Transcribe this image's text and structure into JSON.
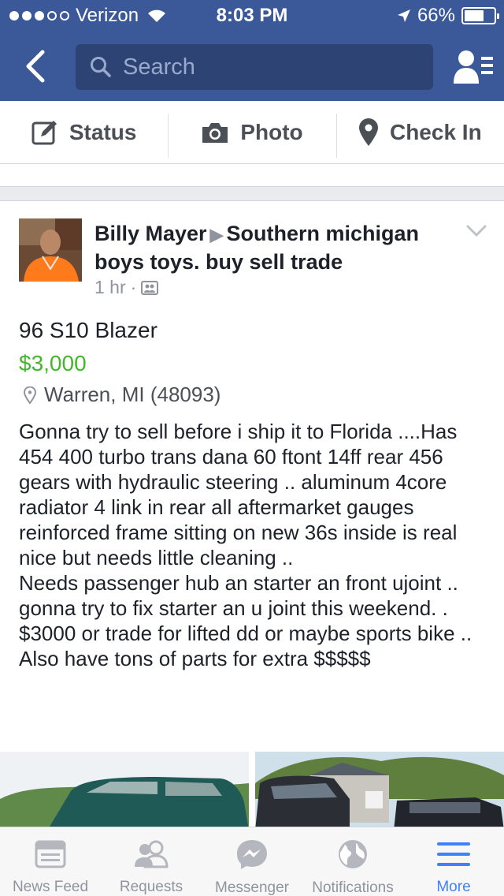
{
  "status_bar": {
    "carrier": "Verizon",
    "time": "8:03 PM",
    "battery": "66%",
    "battery_level": 0.66
  },
  "nav": {
    "search_placeholder": "Search"
  },
  "composer": {
    "status_label": "Status",
    "photo_label": "Photo",
    "checkin_label": "Check In"
  },
  "post": {
    "author": "Billy Mayer",
    "group": "Southern michigan boys toys. buy sell trade",
    "time_ago": "1 hr",
    "title": "96 S10 Blazer",
    "price": "$3,000",
    "location": "Warren, MI (48093)",
    "body": "Gonna try to sell before i ship it to Florida ....Has 454 400 turbo trans dana 60 ftont 14ff rear 456 gears with hydraulic steering .. aluminum 4core radiator  4 link in rear all aftermarket gauges reinforced frame sitting on new 36s inside is real nice but needs little cleaning ..\nNeeds passenger hub an starter an front ujoint .. gonna try to fix starter an u joint this weekend. . $3000 or trade for lifted dd or maybe sports bike .. Also have tons of parts for extra $$$$$"
  },
  "tabs": [
    {
      "label": "News Feed",
      "icon": "news-feed-icon"
    },
    {
      "label": "Requests",
      "icon": "friend-requests-icon"
    },
    {
      "label": "Messenger",
      "icon": "messenger-icon"
    },
    {
      "label": "Notifications",
      "icon": "globe-icon"
    },
    {
      "label": "More",
      "icon": "menu-icon"
    }
  ],
  "colors": {
    "brand": "#3b5998",
    "price": "#42b72a",
    "active_tab": "#4080ff"
  }
}
